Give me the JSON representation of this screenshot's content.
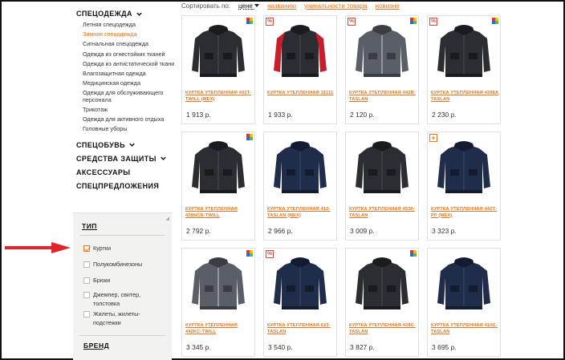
{
  "sidebar": {
    "workwear_title": "СПЕЦОДЕЖДА",
    "workwear_items": [
      {
        "label": "Летняя спецодежда",
        "active": false
      },
      {
        "label": "Зимняя спецодежда",
        "active": true
      },
      {
        "label": "Сигнальная спецодежда",
        "active": false
      },
      {
        "label": "Одежда из огнестойких тканей",
        "active": false
      },
      {
        "label": "Одежда из антистатической ткани",
        "active": false
      },
      {
        "label": "Влагозащитная одежда",
        "active": false
      },
      {
        "label": "Медицинская одежда",
        "active": false
      },
      {
        "label": "Одежда для обслуживающего персонала",
        "active": false
      },
      {
        "label": "Трикотаж",
        "active": false
      },
      {
        "label": "Одежда для активного отдыха",
        "active": false
      },
      {
        "label": "Головные уборы",
        "active": false
      }
    ],
    "footwear": "СПЕЦОБУВЬ",
    "protection": "СРЕДСТВА ЗАЩИТЫ",
    "accessories": "АКСЕССУАРЫ",
    "offers": "СПЕЦПРЕДЛОЖЕНИЯ"
  },
  "filter": {
    "type_title": "ТИП",
    "options": [
      {
        "label": "Куртки",
        "checked": true
      },
      {
        "label": "Полукомбинезоны",
        "checked": false
      },
      {
        "label": "Брюки",
        "checked": false
      },
      {
        "label": "Джемпер, свитер, толстовка",
        "checked": false
      },
      {
        "label": "Жилеты, жилеты-подстежки",
        "checked": false
      }
    ],
    "brand_title": "БРЕНД"
  },
  "sort": {
    "label": "Сортировать по:",
    "active": "цене",
    "options": [
      "названию",
      "уникальности товара",
      "новизне"
    ]
  },
  "colors": {
    "accent": "#e8731c",
    "sale": "#d34a3a",
    "arrow": "#e0242a"
  },
  "products": [
    {
      "name": "КУРТКА УТЕПЛЕННАЯ 442T-TWILL (MEX)",
      "price": "1 913 р.",
      "badge": "",
      "new": true,
      "style": "dark",
      "accent": ""
    },
    {
      "name": "КУРТКА УТЕПЛЕННАЯ 31111",
      "price": "1 933 р.",
      "badge": "sale",
      "new": false,
      "style": "dark",
      "accent": "#c81e2c"
    },
    {
      "name": "КУРТКА УТЕПЛЕННАЯ 442R-TASLAN",
      "price": "2 120 р.",
      "badge": "sale",
      "new": true,
      "style": "grey",
      "accent": ""
    },
    {
      "name": "КУРТКА УТЕПЛЕННАЯ 4398A TASLAN",
      "price": "2 230 р.",
      "badge": "sale",
      "new": true,
      "style": "dark",
      "accent": ""
    },
    {
      "name": "КУРТКА УТЕПЛЕННАЯ 428NCR-TWILL",
      "price": "2 792 р.",
      "badge": "",
      "new": true,
      "style": "dark",
      "accent": ""
    },
    {
      "name": "КУРТКА УТЕПЛЕННАЯ 410-TASLAN (MEX)",
      "price": "2 966 р.",
      "badge": "",
      "new": false,
      "style": "navy",
      "accent": ""
    },
    {
      "name": "КУРТКА УТЕПЛЕННАЯ 4530-TASLAN",
      "price": "3 009 р.",
      "badge": "",
      "new": false,
      "style": "dark",
      "accent": ""
    },
    {
      "name": "КУРТКА УТЕПЛЕННАЯ 442T-PP (MEX)",
      "price": "3 323 р.",
      "badge": "plus",
      "new": false,
      "style": "navy",
      "accent": ""
    },
    {
      "name": "КУРТКА УТЕПЛЕННАЯ 442KC-TWILL",
      "price": "3 345 р.",
      "badge": "",
      "new": true,
      "style": "grey",
      "accent": ""
    },
    {
      "name": "КУРТКА УТЕПЛЕННАЯ 622-TASLAN",
      "price": "3 540 р.",
      "badge": "sale",
      "new": false,
      "style": "navy",
      "accent": ""
    },
    {
      "name": "КУРТКА УТЕПЛЕННАЯ 428C-TASLAN",
      "price": "3 827 р.",
      "badge": "",
      "new": true,
      "style": "dark",
      "accent": ""
    },
    {
      "name": "КУРТКА УТЕПЛЕННАЯ 410C-TASLAN",
      "price": "3 695 р.",
      "badge": "",
      "new": false,
      "style": "navy",
      "accent": ""
    }
  ]
}
